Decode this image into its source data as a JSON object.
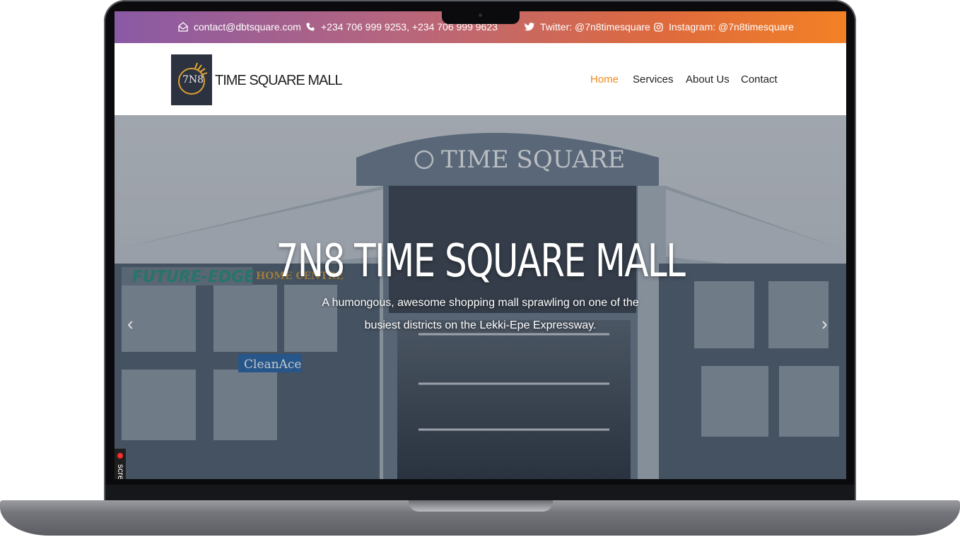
{
  "topbar": {
    "email": "contact@dbtsquare.com",
    "phone": "+234 706 999 9253, +234 706 999 9623",
    "twitter": "Twitter: @7n8timesquare",
    "instagram": "Instagram: @7n8timesquare"
  },
  "brand": {
    "name": "TIME SQUARE MALL",
    "logo_text": "7N8"
  },
  "nav": {
    "home": "Home",
    "services": "Services",
    "about": "About Us",
    "contact": "Contact",
    "active_color": "#f08a22"
  },
  "building_sign": "TIME SQUARE",
  "shop_signs": {
    "future_edge": "FUTURE-EDGE",
    "home_centre": "HOME CENTRE",
    "cleanace": "CleanAce"
  },
  "hero": {
    "title": "7N8 TIME SQUARE MALL",
    "subtitle": "A humongous, awesome shopping mall sprawling on one of the busiest districts on the Lekki-Epe Expressway."
  },
  "overlay": {
    "label": "screenrec"
  },
  "icons": {
    "email": "envelope-icon",
    "phone": "phone-icon",
    "twitter": "twitter-icon",
    "instagram": "instagram-icon",
    "prev": "chevron-left-icon",
    "next": "chevron-right-icon"
  },
  "colors": {
    "gradient_start": "#8a5aa5",
    "gradient_end": "#f28126",
    "accent": "#f08a22"
  }
}
